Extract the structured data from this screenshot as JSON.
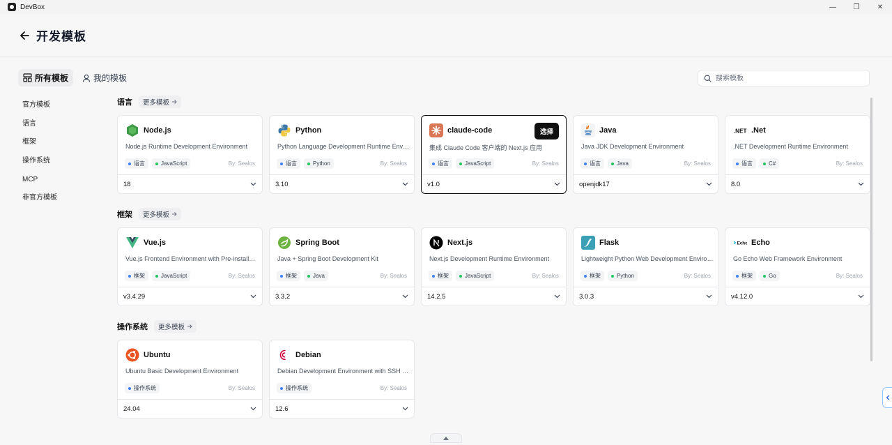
{
  "window": {
    "title": "DevBox",
    "controls": [
      "minimize",
      "restore",
      "close"
    ]
  },
  "header": {
    "title": "开发模板"
  },
  "tabs": [
    {
      "label": "所有模板",
      "icon": "grid-icon",
      "active": true
    },
    {
      "label": "我的模板",
      "icon": "user-icon",
      "active": false
    }
  ],
  "side_nav": [
    "官方模板",
    "语言",
    "框架",
    "操作系统",
    "MCP",
    "非官方模板"
  ],
  "search": {
    "placeholder": "搜索模板",
    "value": ""
  },
  "select_label": "选择",
  "sections": [
    {
      "title": "语言",
      "more": "更多模板",
      "cards": [
        {
          "name": "Node.js",
          "icon": "nodejs-icon",
          "desc": "Node.js Runtime Development Environment",
          "tags": [
            "语言",
            "JavaScript"
          ],
          "author": "By: Sealos",
          "version": "18"
        },
        {
          "name": "Python",
          "icon": "python-icon",
          "desc": "Python Language Development Runtime Environment",
          "tags": [
            "语言",
            "Python"
          ],
          "author": "By: Sealos",
          "version": "3.10"
        },
        {
          "name": "claude-code",
          "icon": "claude-icon",
          "desc": "集成 Claude Code 客户端的 Next.js 应用",
          "tags": [
            "语言",
            "JavaScript"
          ],
          "author": "By: Sealos",
          "version": "v1.0",
          "selected": true
        },
        {
          "name": "Java",
          "icon": "java-icon",
          "desc": "Java JDK Development Environment",
          "tags": [
            "语言",
            "Java"
          ],
          "author": "By: Sealos",
          "version": "openjdk17"
        },
        {
          "name": ".Net",
          "icon": "dotnet-icon",
          "desc": ".NET Development Runtime Environment",
          "tags": [
            "语言",
            "C#"
          ],
          "author": "By: Sealos",
          "version": "8.0"
        }
      ]
    },
    {
      "title": "框架",
      "more": "更多模板",
      "cards": [
        {
          "name": "Vue.js",
          "icon": "vue-icon",
          "desc": "Vue.js Frontend Environment with Pre-installed Tools",
          "tags": [
            "框架",
            "JavaScript"
          ],
          "author": "By: Sealos",
          "version": "v3.4.29"
        },
        {
          "name": "Spring Boot",
          "icon": "spring-icon",
          "desc": "Java + Spring Boot Development Kit",
          "tags": [
            "框架",
            "Java"
          ],
          "author": "By: Sealos",
          "version": "3.3.2"
        },
        {
          "name": "Next.js",
          "icon": "nextjs-icon",
          "desc": "Next.js Development Runtime Environment",
          "tags": [
            "框架",
            "JavaScript"
          ],
          "author": "By: Sealos",
          "version": "14.2.5"
        },
        {
          "name": "Flask",
          "icon": "flask-icon",
          "desc": "Lightweight Python Web Development Environment",
          "tags": [
            "框架",
            "Python"
          ],
          "author": "By: Sealos",
          "version": "3.0.3"
        },
        {
          "name": "Echo",
          "icon": "echo-icon",
          "desc": "Go Echo Web Framework Environment",
          "tags": [
            "框架",
            "Go"
          ],
          "author": "By: Sealos",
          "version": "v4.12.0"
        }
      ]
    },
    {
      "title": "操作系统",
      "more": "更多模板",
      "cards": [
        {
          "name": "Ubuntu",
          "icon": "ubuntu-icon",
          "desc": "Ubuntu Basic Development Environment",
          "tags": [
            "操作系统"
          ],
          "author": "By: Sealos",
          "version": "24.04"
        },
        {
          "name": "Debian",
          "icon": "debian-icon",
          "desc": "Debian Development Environment with SSH Support",
          "tags": [
            "操作系统"
          ],
          "author": "By: Sealos",
          "version": "12.6"
        }
      ]
    }
  ],
  "colors": {
    "accent": "#111111",
    "border": "#e5e7eb",
    "tag_language": "#3b82f6",
    "tag_tech": "#22c55e"
  }
}
